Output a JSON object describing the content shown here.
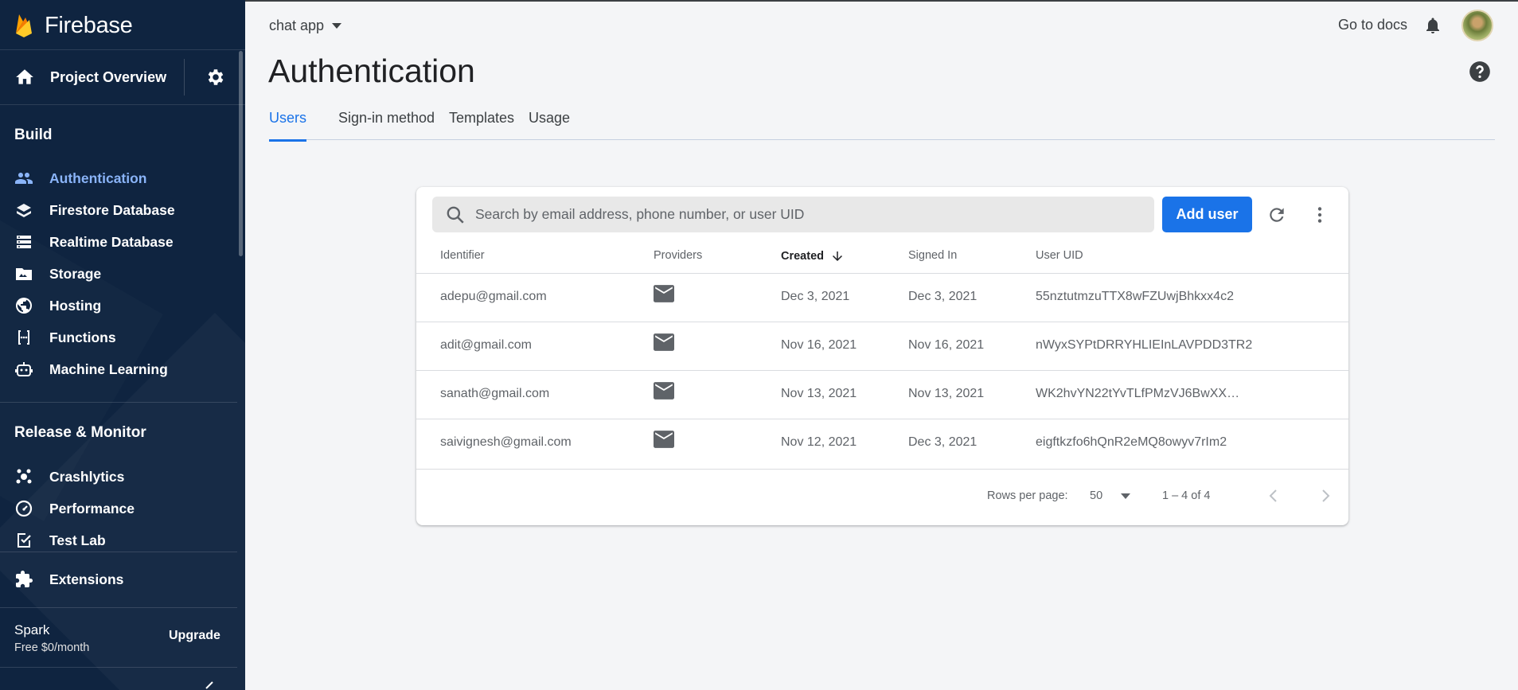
{
  "app": {
    "brand": "Firebase"
  },
  "sidebar": {
    "project_overview": "Project Overview",
    "sections": {
      "build": "Build",
      "release": "Release & Monitor"
    },
    "build_items": [
      {
        "label": "Authentication",
        "icon": "people-icon",
        "active": true
      },
      {
        "label": "Firestore Database",
        "icon": "firestore-icon"
      },
      {
        "label": "Realtime Database",
        "icon": "database-icon"
      },
      {
        "label": "Storage",
        "icon": "folder-icon"
      },
      {
        "label": "Hosting",
        "icon": "globe-icon"
      },
      {
        "label": "Functions",
        "icon": "functions-icon"
      },
      {
        "label": "Machine Learning",
        "icon": "robot-icon"
      }
    ],
    "release_items": [
      {
        "label": "Crashlytics",
        "icon": "crashlytics-icon"
      },
      {
        "label": "Performance",
        "icon": "speedometer-icon"
      },
      {
        "label": "Test Lab",
        "icon": "checklist-icon"
      }
    ],
    "extensions": "Extensions",
    "plan": {
      "name": "Spark",
      "price": "Free $0/month",
      "upgrade": "Upgrade"
    }
  },
  "header": {
    "project": "chat app",
    "go_to_docs": "Go to docs",
    "title": "Authentication"
  },
  "tabs": [
    "Users",
    "Sign-in method",
    "Templates",
    "Usage"
  ],
  "users": {
    "search_placeholder": "Search by email address, phone number, or user UID",
    "add_user": "Add user",
    "columns": [
      "Identifier",
      "Providers",
      "Created",
      "Signed In",
      "User UID"
    ],
    "rows": [
      {
        "identifier": "adepu@gmail.com",
        "provider": "mail-icon",
        "created": "Dec 3, 2021",
        "signed_in": "Dec 3, 2021",
        "uid": "55nztutmzuTTX8wFZUwjBhkxx4c2"
      },
      {
        "identifier": "adit@gmail.com",
        "provider": "mail-icon",
        "created": "Nov 16, 2021",
        "signed_in": "Nov 16, 2021",
        "uid": "nWyxSYPtDRRYHLIEInLAVPDD3TR2"
      },
      {
        "identifier": "sanath@gmail.com",
        "provider": "mail-icon",
        "created": "Nov 13, 2021",
        "signed_in": "Nov 13, 2021",
        "uid": "WK2hvYN22tYvTLfPMzVJ6BwXX…"
      },
      {
        "identifier": "saivignesh@gmail.com",
        "provider": "mail-icon",
        "created": "Nov 12, 2021",
        "signed_in": "Dec 3, 2021",
        "uid": "eigftkzfo6hQnR2eMQ8owyv7rIm2"
      }
    ],
    "footer": {
      "rows_per_page_label": "Rows per page:",
      "rows_per_page": "50",
      "range": "1 – 4 of 4"
    }
  },
  "colors": {
    "sidebar_bg": "#0f2440",
    "accent": "#1a73e8",
    "active_nav": "#8ab4f8"
  }
}
